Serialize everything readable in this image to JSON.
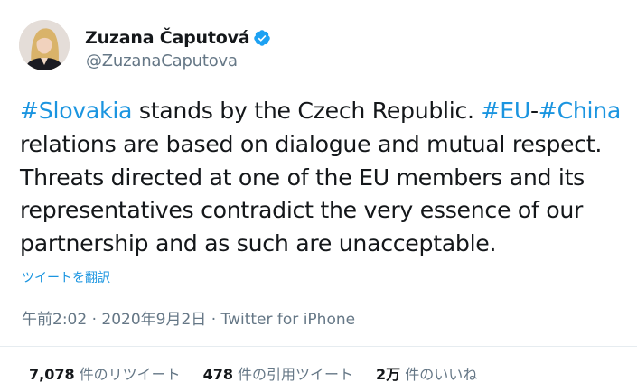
{
  "author": {
    "display_name": "Zuzana Čaputová",
    "handle": "@ZuzanaCaputova",
    "verified_icon": "verified-badge-icon",
    "verified_color": "#1da1f2"
  },
  "tweet": {
    "lines": [
      [
        {
          "t": "#Slovakia",
          "tag": true
        },
        {
          "t": " stands by the Czech Republic. "
        },
        {
          "t": "#EU",
          "tag": true
        },
        {
          "t": "-"
        },
        {
          "t": "#China",
          "tag": true
        }
      ],
      [
        {
          "t": "relations are based on dialogue and mutual respect."
        }
      ],
      [
        {
          "t": "Threats directed at one of the EU members and its"
        }
      ],
      [
        {
          "t": "representatives contradict the very essence of our"
        }
      ],
      [
        {
          "t": "partnership and as such are unacceptable."
        }
      ]
    ],
    "hashtag_color": "#1b95e0"
  },
  "translate_label": "ツイートを翻訳",
  "meta": {
    "time": "午前2:02",
    "date": "2020年9月2日",
    "separator": "·",
    "source": "Twitter for iPhone"
  },
  "stats": [
    {
      "num": "7,078",
      "label": "件のリツイート"
    },
    {
      "num": "478",
      "label": "件の引用ツイート"
    },
    {
      "num": "2万",
      "label": "件のいいね"
    }
  ]
}
